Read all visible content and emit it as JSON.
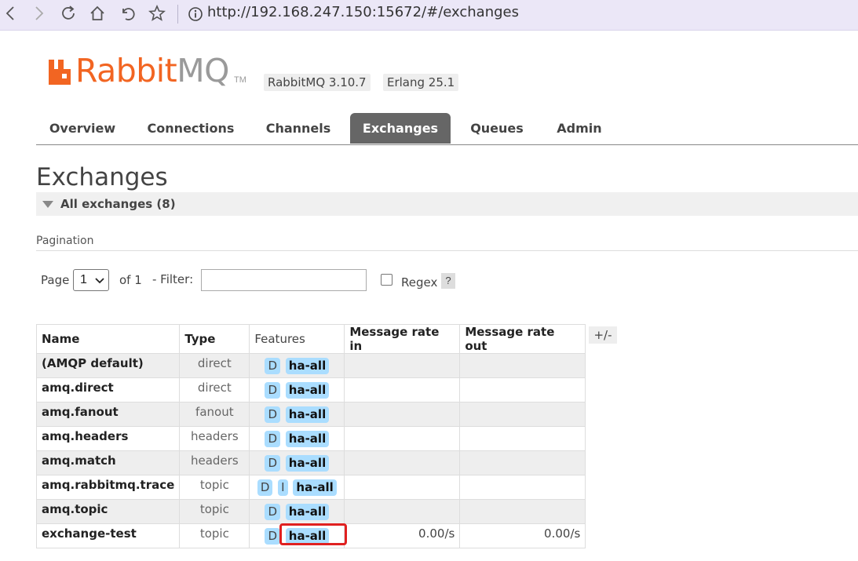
{
  "browser": {
    "url": "http://192.168.247.150:15672/#/exchanges",
    "icons": [
      "back-icon",
      "forward-icon",
      "reload-icon",
      "home-icon",
      "undo-icon",
      "star-icon",
      "info-icon"
    ]
  },
  "header": {
    "logo_rabbit": "Rabbit",
    "logo_mq": "MQ",
    "logo_tm": "TM",
    "brand_color": "#f26522",
    "version_badge": "RabbitMQ 3.10.7",
    "erlang_badge": "Erlang 25.1"
  },
  "tabs": [
    {
      "label": "Overview",
      "active": false
    },
    {
      "label": "Connections",
      "active": false
    },
    {
      "label": "Channels",
      "active": false
    },
    {
      "label": "Exchanges",
      "active": true
    },
    {
      "label": "Queues",
      "active": false
    },
    {
      "label": "Admin",
      "active": false
    }
  ],
  "page_title": "Exchanges",
  "section": {
    "label": "All exchanges (8)"
  },
  "pagination": {
    "label": "Pagination",
    "page_label": "Page",
    "page_value": "1",
    "of_label": "of 1",
    "filter_label": "- Filter:",
    "filter_value": "",
    "regex_label": "Regex",
    "regex_checked": false,
    "help_label": "?"
  },
  "table": {
    "columns": [
      "Name",
      "Type",
      "Features",
      "Message rate in",
      "Message rate out"
    ],
    "toggle_label": "+/-",
    "rows": [
      {
        "name": "(AMQP default)",
        "type": "direct",
        "features": [
          "D"
        ],
        "policy": "ha-all",
        "rate_in": "",
        "rate_out": ""
      },
      {
        "name": "amq.direct",
        "type": "direct",
        "features": [
          "D"
        ],
        "policy": "ha-all",
        "rate_in": "",
        "rate_out": ""
      },
      {
        "name": "amq.fanout",
        "type": "fanout",
        "features": [
          "D"
        ],
        "policy": "ha-all",
        "rate_in": "",
        "rate_out": ""
      },
      {
        "name": "amq.headers",
        "type": "headers",
        "features": [
          "D"
        ],
        "policy": "ha-all",
        "rate_in": "",
        "rate_out": ""
      },
      {
        "name": "amq.match",
        "type": "headers",
        "features": [
          "D"
        ],
        "policy": "ha-all",
        "rate_in": "",
        "rate_out": ""
      },
      {
        "name": "amq.rabbitmq.trace",
        "type": "topic",
        "features": [
          "D",
          "I"
        ],
        "policy": "ha-all",
        "rate_in": "",
        "rate_out": ""
      },
      {
        "name": "amq.topic",
        "type": "topic",
        "features": [
          "D"
        ],
        "policy": "ha-all",
        "rate_in": "",
        "rate_out": ""
      },
      {
        "name": "exchange-test",
        "type": "topic",
        "features": [
          "D"
        ],
        "policy": "ha-all",
        "rate_in": "0.00/s",
        "rate_out": "0.00/s"
      }
    ],
    "badge_color": "#aaddff",
    "highlight_color": "#e02020"
  }
}
